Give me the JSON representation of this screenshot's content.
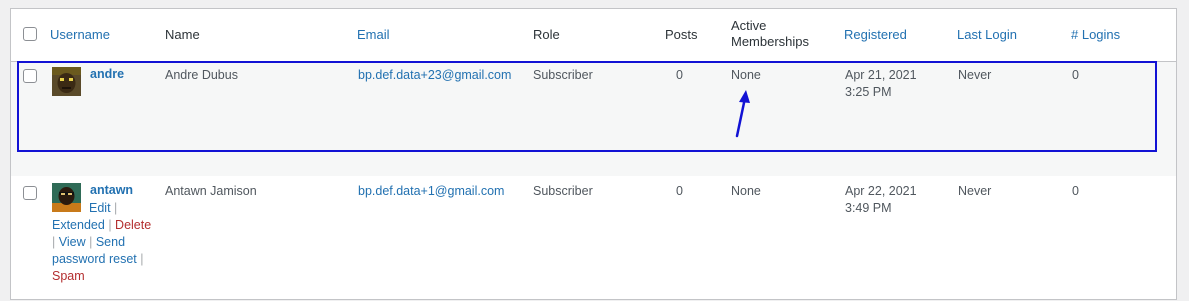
{
  "headers": {
    "username": "Username",
    "name": "Name",
    "email": "Email",
    "role": "Role",
    "posts": "Posts",
    "active_line1": "Active",
    "active_line2": "Memberships",
    "registered": "Registered",
    "last_login": "Last Login",
    "logins": "# Logins"
  },
  "rows": [
    {
      "username": "andre",
      "name": "Andre Dubus",
      "email": "bp.def.data+23@gmail.com",
      "role": "Subscriber",
      "posts": "0",
      "memberships": "None",
      "registered_date": "Apr 21, 2021",
      "registered_time": "3:25 PM",
      "last_login": "Never",
      "logins": "0"
    },
    {
      "username": "antawn",
      "name": "Antawn Jamison",
      "email": "bp.def.data+1@gmail.com",
      "role": "Subscriber",
      "posts": "0",
      "memberships": "None",
      "registered_date": "Apr 22, 2021",
      "registered_time": "3:49 PM",
      "last_login": "Never",
      "logins": "0",
      "actions": {
        "edit": "Edit",
        "extended": "Extended",
        "delete": "Delete",
        "view": "View",
        "send_reset_1": "Send",
        "send_reset_2": "password reset",
        "spam": "Spam",
        "separator": "|"
      }
    }
  ],
  "colors": {
    "link": "#2271b1",
    "delete": "#b32d2e",
    "annotation": "#1212d4"
  }
}
